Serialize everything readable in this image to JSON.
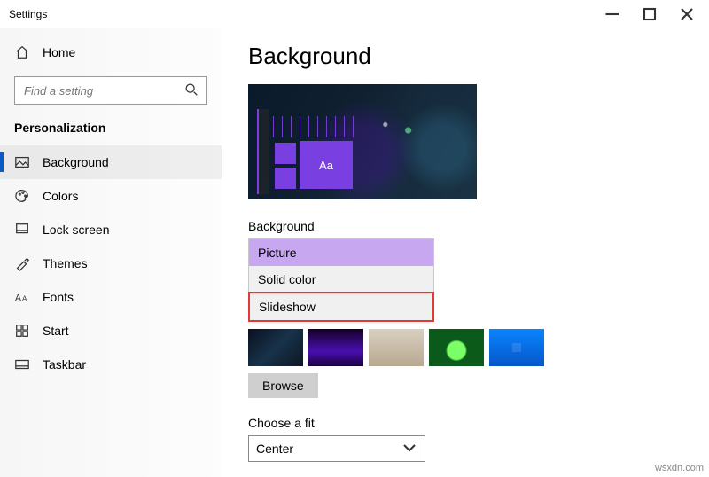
{
  "window": {
    "title": "Settings"
  },
  "sidebar": {
    "home": "Home",
    "search_placeholder": "Find a setting",
    "section": "Personalization",
    "items": [
      {
        "label": "Background",
        "active": true
      },
      {
        "label": "Colors"
      },
      {
        "label": "Lock screen"
      },
      {
        "label": "Themes"
      },
      {
        "label": "Fonts"
      },
      {
        "label": "Start"
      },
      {
        "label": "Taskbar"
      }
    ]
  },
  "page": {
    "title": "Background",
    "preview_tile_text": "Aa",
    "bg_label": "Background",
    "bg_options": [
      {
        "label": "Picture",
        "selected": true
      },
      {
        "label": "Solid color"
      },
      {
        "label": "Slideshow",
        "highlight": true
      }
    ],
    "browse": "Browse",
    "fit_label": "Choose a fit",
    "fit_value": "Center"
  },
  "watermark": "wsxdn.com"
}
